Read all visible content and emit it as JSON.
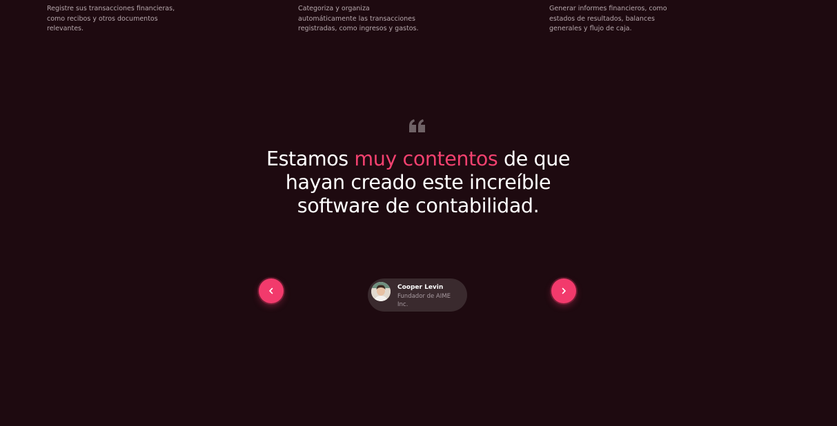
{
  "features": [
    {
      "description": "Registre sus transacciones financieras, como recibos y otros documentos relevantes."
    },
    {
      "description": "Categoriza y organiza automáticamente las transacciones registradas, como ingresos y gastos."
    },
    {
      "description": "Generar informes financieros, como estados de resultados, balances generales y flujo de caja."
    }
  ],
  "testimonial": {
    "quote_icon": "quote-icon",
    "quote_before": "Estamos ",
    "quote_highlight": "muy contentos",
    "quote_after": " de que hayan creado este increíble software de contabilidad.",
    "author_name": "Cooper Levin",
    "author_role": "Fundador de AIME Inc.",
    "prev_icon": "chevron-left-icon",
    "next_icon": "chevron-right-icon"
  },
  "colors": {
    "background": "#1e0a10",
    "accent": "#f23a6c",
    "highlight_text": "#f2416f",
    "card": "#3a2a2e"
  }
}
